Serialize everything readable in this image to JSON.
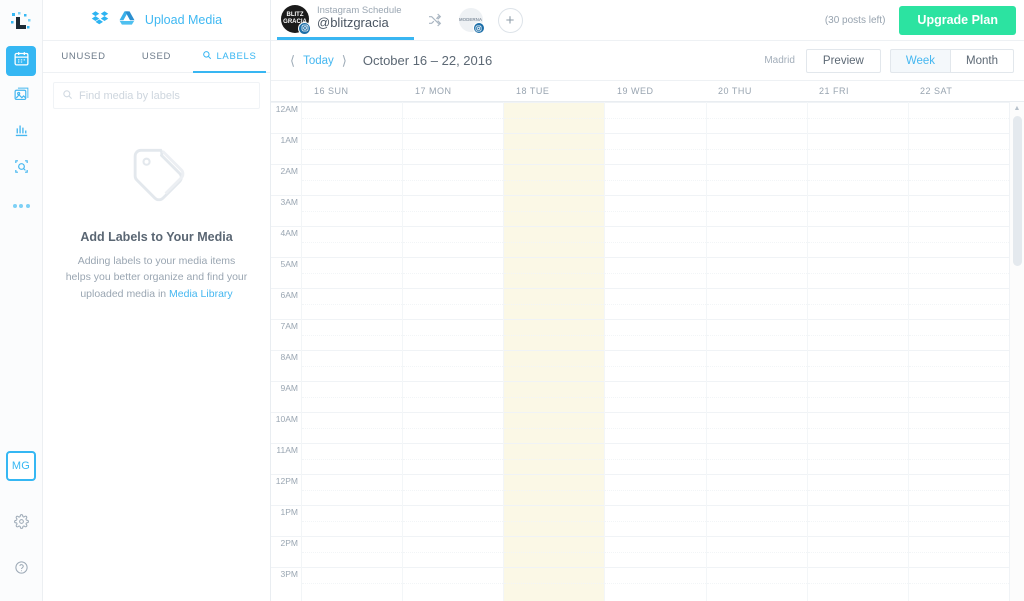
{
  "rail": {
    "logo_icon": "app-logo-icon",
    "nav": [
      {
        "name": "calendar",
        "icon": "calendar-icon",
        "active": true
      },
      {
        "name": "media",
        "icon": "image-icon",
        "active": false
      },
      {
        "name": "analytics",
        "icon": "bar-chart-icon",
        "active": false
      },
      {
        "name": "discover",
        "icon": "discover-icon",
        "active": false
      }
    ],
    "more_icon": "more-dots-icon",
    "avatar_initials": "MG",
    "settings_icon": "gear-icon",
    "help_icon": "help-circle-icon"
  },
  "media_panel": {
    "dropbox_icon": "dropbox-icon",
    "gdrive_icon": "google-drive-icon",
    "upload_label": "Upload Media",
    "tabs": [
      {
        "label": "UNUSED",
        "active": false
      },
      {
        "label": "USED",
        "active": false
      },
      {
        "label": "LABELS",
        "active": true
      }
    ],
    "search_placeholder": "Find media by labels",
    "search_value": "",
    "empty_title": "Add Labels to Your Media",
    "empty_desc_1": "Adding labels to your media items helps you better organize and find your uploaded media in ",
    "empty_link": "Media Library"
  },
  "topbar": {
    "account": {
      "avatar_text": "BLITZ GRACIA",
      "label": "Instagram Schedule",
      "handle": "@blitzgracia",
      "network_icon": "instagram-icon"
    },
    "shuffle_icon": "shuffle-icon",
    "secondary_account": {
      "avatar_text": "MODERNA",
      "network_icon": "instagram-icon"
    },
    "add_account_label": "+",
    "posts_left": "(30 posts left)",
    "upgrade_label": "Upgrade Plan",
    "upgrade_color": "#2ce3a1"
  },
  "calendar_toolbar": {
    "prev_icon": "chevron-left-icon",
    "today_label": "Today",
    "next_icon": "chevron-right-icon",
    "date_range": "October 16 – 22, 2016",
    "timezone": "Madrid",
    "preview_label": "Preview",
    "views": [
      {
        "label": "Week",
        "active": true
      },
      {
        "label": "Month",
        "active": false
      }
    ]
  },
  "calendar": {
    "days": [
      {
        "label": "16 SUN",
        "highlight": false
      },
      {
        "label": "17 MON",
        "highlight": false
      },
      {
        "label": "18 TUE",
        "highlight": true
      },
      {
        "label": "19 WED",
        "highlight": false
      },
      {
        "label": "20 THU",
        "highlight": false
      },
      {
        "label": "21 FRI",
        "highlight": false
      },
      {
        "label": "22 SAT",
        "highlight": false
      }
    ],
    "hours": [
      "12AM",
      "1AM",
      "2AM",
      "3AM",
      "4AM",
      "5AM",
      "6AM",
      "7AM",
      "8AM",
      "9AM",
      "10AM",
      "11AM",
      "12PM",
      "1PM",
      "2PM",
      "3PM"
    ],
    "hour_height": 31,
    "highlight_color": "#fbf8e6"
  }
}
